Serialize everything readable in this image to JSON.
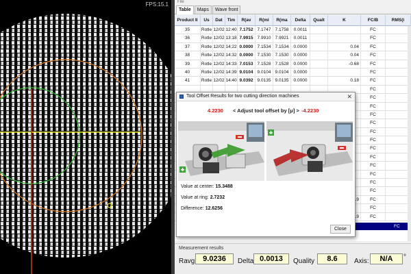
{
  "camera": {
    "fps_label": "FPS:15.1"
  },
  "app": {
    "filebar_label": "File"
  },
  "tabs": [
    {
      "label": "Table",
      "active": true
    },
    {
      "label": "Maps",
      "active": false
    },
    {
      "label": "Wave front",
      "active": false
    }
  ],
  "grid": {
    "headers": [
      "Product II",
      "Us",
      "Dat",
      "Tim",
      "R(av",
      "R(mi",
      "R(ma",
      "Delta",
      "Qualt",
      "K",
      "FC/B",
      "RMS(i"
    ],
    "rows": [
      [
        "35",
        "Rotle",
        "12/02",
        "12:40",
        "7.1752",
        "7.1747",
        "7.1758",
        "0.0011",
        "",
        "",
        "FC",
        ""
      ],
      [
        "36",
        "Rotle",
        "12/02",
        "13:18",
        "7.9915",
        "7.9910",
        "7.9921",
        "0.0011",
        "",
        "",
        "FC",
        ""
      ],
      [
        "37",
        "Rotle",
        "12/02",
        "14:22",
        "0.0000",
        "7.1534",
        "7.1534",
        "0.0000",
        "",
        "0.04",
        "FC",
        ""
      ],
      [
        "38",
        "Rotle",
        "12/02",
        "14:32",
        "0.0000",
        "7.1530",
        "7.1530",
        "0.0000",
        "",
        "0.04",
        "FC",
        ""
      ],
      [
        "39",
        "Rotle",
        "12/02",
        "14:33",
        "7.0153",
        "7.1528",
        "7.1528",
        "0.0000",
        "",
        "-0.68",
        "FC",
        ""
      ],
      [
        "40",
        "Rotle",
        "12/02",
        "14:39",
        "9.0104",
        "9.0104",
        "9.0104",
        "0.0000",
        "",
        "",
        "FC",
        ""
      ],
      [
        "41",
        "Rotle",
        "12/02",
        "14:40",
        "9.0392",
        "9.0135",
        "9.0135",
        "0.0000",
        "",
        "0.18",
        "FC",
        ""
      ],
      [
        "",
        "",
        "",
        "",
        "",
        "",
        "",
        "",
        "",
        "",
        "FC",
        ""
      ],
      [
        "",
        "",
        "",
        "",
        "",
        "",
        "",
        "",
        "",
        "",
        "FC",
        ""
      ],
      [
        "",
        "",
        "",
        "",
        "",
        "",
        "",
        "",
        "",
        "",
        "FC",
        ""
      ],
      [
        "",
        "",
        "",
        "",
        "",
        "",
        "",
        "",
        "",
        "",
        "FC",
        ""
      ],
      [
        "",
        "",
        "",
        "",
        "",
        "",
        "",
        "",
        "",
        "",
        "FC",
        ""
      ],
      [
        "",
        "",
        "",
        "",
        "",
        "",
        "",
        "",
        "",
        "",
        "FC",
        ""
      ],
      [
        "",
        "",
        "",
        "",
        "",
        "",
        "",
        "",
        "",
        "",
        "FC",
        ""
      ],
      [
        "",
        "",
        "",
        "",
        "",
        "",
        "",
        "",
        "",
        "",
        "FC",
        ""
      ],
      [
        "",
        "",
        "",
        "",
        "",
        "",
        "",
        "",
        "",
        "",
        "FC",
        ""
      ],
      [
        "",
        "",
        "",
        "",
        "",
        "",
        "",
        "",
        "",
        "",
        "FC",
        ""
      ],
      [
        "",
        "",
        "",
        "",
        "",
        "",
        "",
        "",
        "",
        "",
        "FC",
        ""
      ],
      [
        "",
        "",
        "",
        "",
        "",
        "",
        "",
        "",
        "",
        "",
        "FC",
        ""
      ],
      [
        "",
        "",
        "",
        "",
        "",
        "",
        "",
        "",
        "",
        "",
        "FC",
        ""
      ],
      [
        "",
        "",
        "",
        "",
        "",
        "",
        "",
        "",
        "",
        "0.19",
        "FC",
        ""
      ],
      [
        "",
        "",
        "",
        "",
        "",
        "",
        "",
        "",
        "",
        "",
        "FC",
        ""
      ],
      [
        "",
        "",
        "",
        "",
        "",
        "",
        "",
        "",
        "",
        "0.19",
        "FC",
        ""
      ]
    ],
    "selected_row_cell": "FC"
  },
  "results": {
    "title": "Measurement results",
    "ravg_label": "Ravg:",
    "ravg_value": "9.0236",
    "delta_label": "Delta:",
    "delta_value": "0.0013",
    "quality_label": "Quality",
    "quality_value": "8.6",
    "axis_label": "Axis:",
    "axis_value": "N/A",
    "axis_unit": "°"
  },
  "dialog": {
    "title": "Tool Offset Results for two cutting direction machines",
    "offset_left": "4.2230",
    "adjust_label": "< Adjust tool offset by [μ] >",
    "offset_right": "-4.2230",
    "center_label": "Value at center:",
    "center_value": "15.3488",
    "ring_label": "Value at ring:",
    "ring_value": "2.7232",
    "diff_label": "Difference:",
    "diff_value": "12.6256",
    "close_label": "Close",
    "colors": {
      "offset": "#d01818",
      "arrow_left": "#3a9a2a",
      "arrow_right": "#b52020"
    }
  }
}
